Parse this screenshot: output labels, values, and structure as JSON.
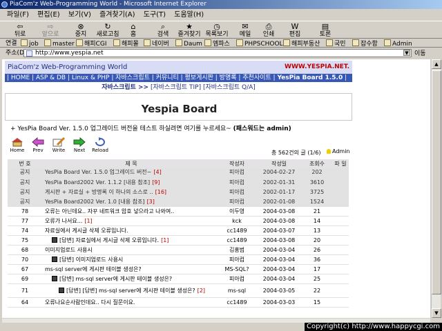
{
  "window": {
    "title": "PiaCom'z Web-Programming World - Microsoft Internet Explorer"
  },
  "menu": [
    "파일(F)",
    "편집(E)",
    "보기(V)",
    "즐겨찾기(A)",
    "도구(T)",
    "도움말(H)"
  ],
  "toolbar": {
    "back": "뒤로",
    "forward": "앞으로",
    "stop": "중지",
    "refresh": "새로고침",
    "home": "홈",
    "search": "검색",
    "favorites": "즐겨찾기",
    "history": "목록보기",
    "mail": "메일",
    "print": "인쇄",
    "edit": "편집",
    "discuss": "토론"
  },
  "links": {
    "label": "연결",
    "items": [
      "job",
      "master",
      "해피CGI",
      "해피몰",
      "네이버",
      "Daum",
      "엠파스",
      "PHPSCHOOL",
      "해피부동산",
      "국민",
      "잡수함",
      "Admin"
    ]
  },
  "address": {
    "label": "주소(D)",
    "url": "http://www.yespia.net",
    "go": "이동"
  },
  "site": {
    "name": "PiaCom'z Web-Programming World",
    "url": "WWW.YESPIA.NET.",
    "nav_prefix": "| HOME | ASP & DB | Linux & PHP | 자바스크립트 | 커뮤니티 | 평보게시판 | 방명록 | 추천사이트 |",
    "nav_current": "YesPia Board 1.5.0",
    "nav_suffix": "|",
    "subnav_bold": "자바스크립트 >>",
    "subnav_rest": "[자바스크립트 TIP] [자바스크립트 Q/A]"
  },
  "board": {
    "title": "Yespia Board",
    "notice_text": "+ YesPia Board Ver. 1.5.0 업그레이드 버전을 테스트 하실려면 여기를 누르세요~",
    "notice_bold": "(패스워드는 admin)",
    "actions": {
      "home": "Home",
      "prev": "Prev",
      "write": "Write",
      "next": "Next",
      "reload": "Reload"
    },
    "post_count": "총 562건의 글 (1/6)",
    "admin": "Admin",
    "columns": {
      "num": "번 호",
      "title": "제 목",
      "author": "작성자",
      "date": "작성일",
      "views": "조회수",
      "file": "파 일"
    },
    "rows": [
      {
        "num": "공지",
        "title": "YesPia Board Ver. 1.5.0 업그레이드 버전~",
        "count": "[4]",
        "author": "피아컴",
        "date": "2004-02-27",
        "views": "202",
        "reply": "",
        "pinned": "yes"
      },
      {
        "num": "공지",
        "title": "YesPia Board2002 Ver. 1.1.2 [내용 참조]",
        "count": "[9]",
        "author": "피아컴",
        "date": "2002-01-31",
        "views": "3610",
        "reply": "",
        "pinned": "yes"
      },
      {
        "num": "공지",
        "title": "게시판 + 자료실 + 방명록 이 하나의 소스로 ..",
        "count": "[16]",
        "author": "피아컴",
        "date": "2002-01-17",
        "views": "3725",
        "reply": "",
        "pinned": "yes"
      },
      {
        "num": "공지",
        "title": "YesPia Board2002 Ver. 1.0 [내용 참조]",
        "count": "[3]",
        "author": "피아컴",
        "date": "2002-01-08",
        "views": "1524",
        "reply": "",
        "pinned": "yes"
      },
      {
        "num": "78",
        "title": "오류는 아닌데요.. 자꾸 네트워크 암호 넣으라고 나와여..",
        "count": "",
        "author": "이두영",
        "date": "2004-03-08",
        "views": "21",
        "reply": "",
        "pinned": ""
      },
      {
        "num": "77",
        "title": "오류가 나서요...",
        "count": "[1]",
        "author": "kck",
        "date": "2004-03-08",
        "views": "14",
        "reply": "",
        "pinned": ""
      },
      {
        "num": "74",
        "title": "자료실에서 게시글 삭제 오류입니다.",
        "count": "",
        "author": "cc1489",
        "date": "2004-03-07",
        "views": "13",
        "reply": "",
        "pinned": ""
      },
      {
        "num": "75",
        "title": "[답변] 자료실에서 게시글 삭제 오류입니다.",
        "count": "[1]",
        "author": "cc1489",
        "date": "2004-03-08",
        "views": "20",
        "reply": "yes",
        "pinned": ""
      },
      {
        "num": "68",
        "title": "이미지업로드 사용시",
        "count": "",
        "author": "김홍범",
        "date": "2004-03-04",
        "views": "26",
        "reply": "",
        "pinned": ""
      },
      {
        "num": "70",
        "title": "[답변] 이미지업로드 사용시",
        "count": "",
        "author": "피아컴",
        "date": "2004-03-04",
        "views": "36",
        "reply": "yes",
        "pinned": ""
      },
      {
        "num": "67",
        "title": "ms-sql server에 게시판 테이블 생성은?",
        "count": "",
        "author": "MS-SQL?",
        "date": "2004-03-04",
        "views": "17",
        "reply": "",
        "pinned": ""
      },
      {
        "num": "69",
        "title": "[답변] ms-sql server에 게시판 테이블 생성은?",
        "count": "",
        "author": "피아컴",
        "date": "2004-03-04",
        "views": "25",
        "reply": "yes",
        "pinned": ""
      },
      {
        "num": "71",
        "title": "[답변] [답변] ms-sql server에 게시판 테이블 생성은?",
        "count": "[2]",
        "author": "ms-sql",
        "date": "2004-03-05",
        "views": "22",
        "reply": "yes2",
        "pinned": ""
      },
      {
        "num": "64",
        "title": "오류나요순사람인데요.. 다시 질문이요.",
        "count": "",
        "author": "cc1489",
        "date": "2004-03-03",
        "views": "15",
        "reply": "",
        "pinned": ""
      }
    ]
  },
  "status": {
    "copyright": "Copyright(c) http://www.happycgi.com"
  }
}
